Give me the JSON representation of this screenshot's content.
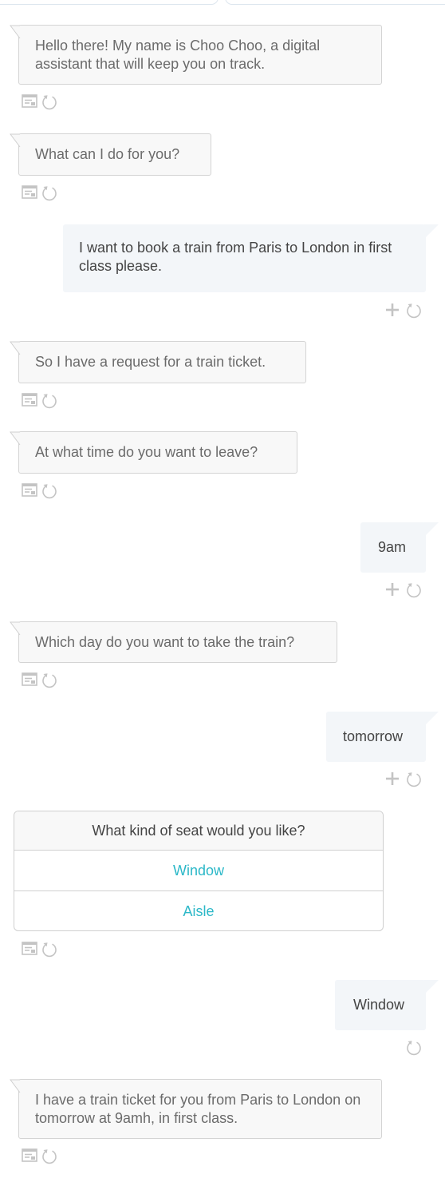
{
  "messages": {
    "greeting": "Hello there! My name is Choo Choo, a digital assistant that will keep you on track.",
    "ask_help": "What can I do for you?",
    "user_request": "I want to book a train from Paris to London in first class please.",
    "ack_request": "So I have a request for a train ticket.",
    "ask_time": "At what time do you want to leave?",
    "user_time": "9am",
    "ask_day": "Which day do you want to take the train?",
    "user_day": "tomorrow",
    "user_seat": "Window",
    "confirmation": "I have a train ticket for you from Paris to London on tomorrow at 9amh, in first class."
  },
  "seat_card": {
    "question": "What kind of seat would you like?",
    "options": [
      "Window",
      "Aisle"
    ]
  },
  "colors": {
    "bot_bubble": "#f8f8f8",
    "user_bubble": "#f3f6f9",
    "option_accent": "#2cb8c8",
    "icon": "#c4c4c4"
  },
  "icons": {
    "bot_actions": [
      "message-log-icon",
      "retry-icon"
    ],
    "user_actions": [
      "add-icon",
      "retry-icon"
    ]
  }
}
